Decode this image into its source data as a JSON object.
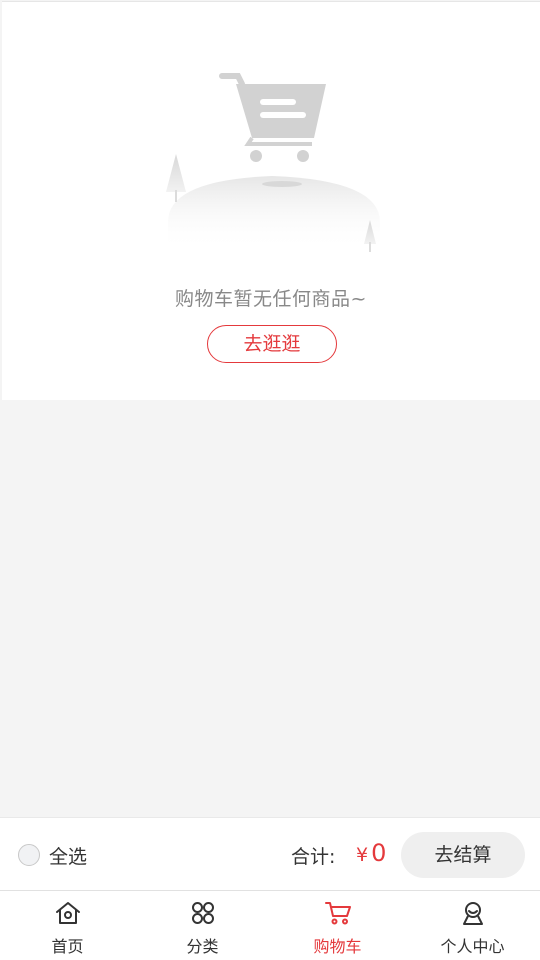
{
  "cart": {
    "empty_message": "购物车暂无任何商品~",
    "go_shopping_label": "去逛逛"
  },
  "checkout": {
    "select_all_label": "全选",
    "total_label": "合计:",
    "currency_symbol": "¥",
    "total_amount": "0",
    "checkout_button_label": "去结算"
  },
  "tabs": [
    {
      "label": "首页",
      "icon": "home-icon",
      "active": false
    },
    {
      "label": "分类",
      "icon": "category-grid-icon",
      "active": false
    },
    {
      "label": "购物车",
      "icon": "cart-icon",
      "active": true
    },
    {
      "label": "个人中心",
      "icon": "user-icon",
      "active": false
    }
  ],
  "colors": {
    "accent": "#e4393c",
    "background": "#f4f4f4",
    "text": "#333333",
    "muted_text": "#888888"
  }
}
